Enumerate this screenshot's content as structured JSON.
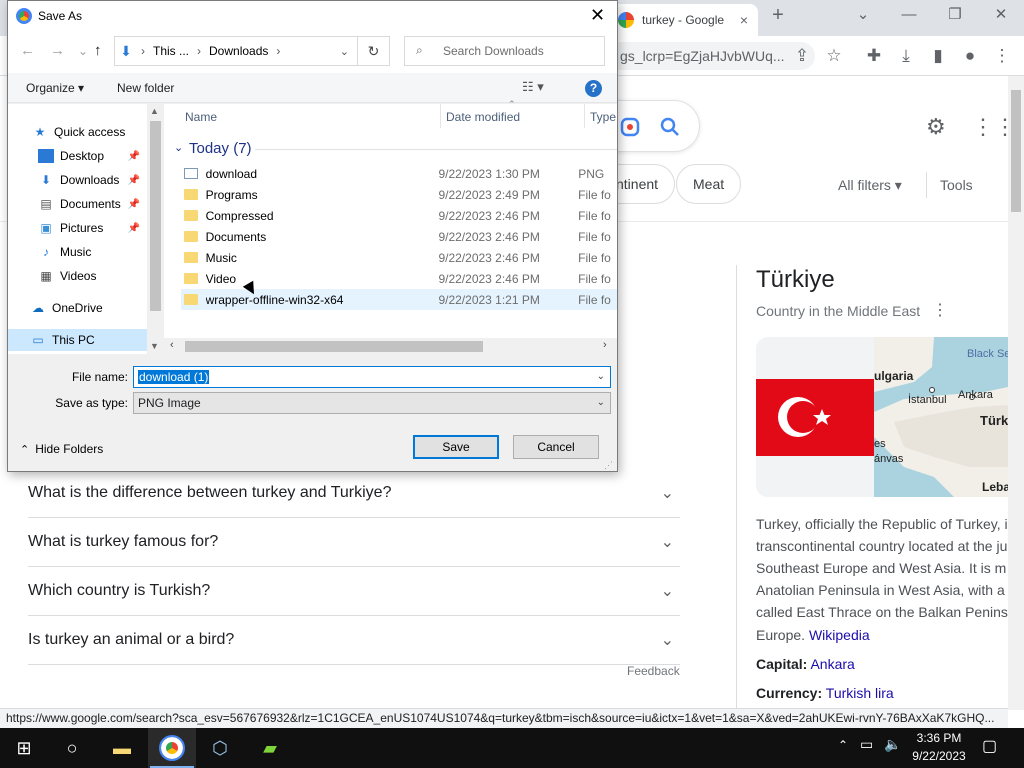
{
  "browser": {
    "tab_title": "turkey - Google",
    "tab_close": "×",
    "new_tab": "+",
    "url_fragment": "gs_lcrp=EgZjaHJvbWUq...",
    "minimize": "—",
    "restore": "❐",
    "close": "✕",
    "collapse": "⌄"
  },
  "google": {
    "chips": [
      "ntinent",
      "Meat"
    ],
    "all_filters": "All filters ▾",
    "tools": "Tools",
    "faqs": [
      "What is the difference between turkey and Turkiye?",
      "What is turkey famous for?",
      "Which country is Turkish?",
      "Is turkey an animal or a bird?"
    ],
    "feedback": "Feedback",
    "kp_title": "Türkiye",
    "kp_subtitle": "Country in the Middle East",
    "map_labels": [
      "Black Se",
      "ulgaria",
      "İstanbul",
      "Ankara",
      "Türk",
      "es",
      "ánvas",
      "Leba"
    ],
    "kp_desc": [
      "Turkey, officially the Republic of Turkey, i",
      "transcontinental country located at the ju",
      "Southeast Europe and West Asia. It is m",
      "Anatolian Peninsula in West Asia, with a",
      "called East Thrace on the Balkan Penins",
      "Europe."
    ],
    "wikipedia": "Wikipedia",
    "capital_label": "Capital:",
    "capital_value": "Ankara",
    "currency_label": "Currency:",
    "currency_value": "Turkish lira"
  },
  "status_url": "https://www.google.com/search?sca_esv=567676932&rlz=1C1GCEA_enUS1074US1074&q=turkey&tbm=isch&source=iu&ictx=1&vet=1&sa=X&ved=2ahUKEwi-rvnY-76BAxXaK7kGHQ...",
  "dialog": {
    "title": "Save As",
    "close": "✕",
    "breadcrumb": [
      "This ...",
      "Downloads"
    ],
    "search_placeholder": "Search Downloads",
    "organize": "Organize ▾",
    "new_folder": "New folder",
    "help": "?",
    "nav_items": [
      {
        "label": "Quick access",
        "icon": "star-icon"
      },
      {
        "label": "Desktop",
        "icon": "desktop-icon",
        "pinned": true
      },
      {
        "label": "Downloads",
        "icon": "download-icon",
        "pinned": true
      },
      {
        "label": "Documents",
        "icon": "documents-icon",
        "pinned": true
      },
      {
        "label": "Pictures",
        "icon": "pictures-icon",
        "pinned": true
      },
      {
        "label": "Music",
        "icon": "music-icon"
      },
      {
        "label": "Videos",
        "icon": "videos-icon"
      },
      {
        "label": "OneDrive",
        "icon": "cloud-icon"
      },
      {
        "label": "This PC",
        "icon": "computer-icon"
      }
    ],
    "columns": {
      "name": "Name",
      "date": "Date modified",
      "type": "Type"
    },
    "group": "Today (7)",
    "files": [
      {
        "name": "download",
        "date": "9/22/2023 1:30 PM",
        "type": "PNG",
        "kind": "png"
      },
      {
        "name": "Programs",
        "date": "9/22/2023 2:49 PM",
        "type": "File fo",
        "kind": "folder"
      },
      {
        "name": "Compressed",
        "date": "9/22/2023 2:46 PM",
        "type": "File fo",
        "kind": "folder"
      },
      {
        "name": "Documents",
        "date": "9/22/2023 2:46 PM",
        "type": "File fo",
        "kind": "folder"
      },
      {
        "name": "Music",
        "date": "9/22/2023 2:46 PM",
        "type": "File fo",
        "kind": "folder"
      },
      {
        "name": "Video",
        "date": "9/22/2023 2:46 PM",
        "type": "File fo",
        "kind": "folder"
      },
      {
        "name": "wrapper-offline-win32-x64",
        "date": "9/22/2023 1:21 PM",
        "type": "File fo",
        "kind": "folder"
      }
    ],
    "file_name_label": "File name:",
    "file_name_value": "download (1)",
    "save_type_label": "Save as type:",
    "save_type_value": "PNG Image",
    "hide_folders": "Hide Folders",
    "save": "Save",
    "cancel": "Cancel"
  },
  "taskbar": {
    "time": "3:36 PM",
    "date": "9/22/2023"
  }
}
